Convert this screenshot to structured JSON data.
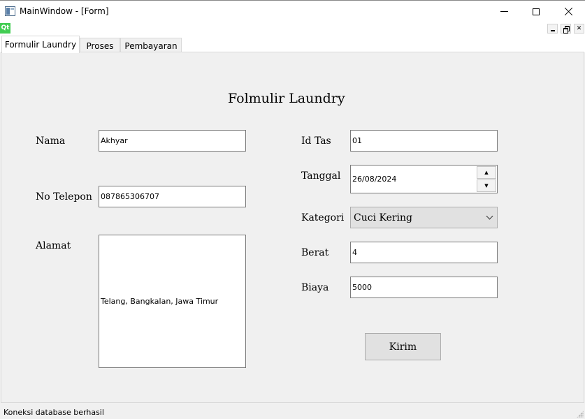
{
  "window": {
    "title": "MainWindow - [Form]",
    "qt_logo_text": "Qt"
  },
  "tabs": [
    {
      "label": "Formulir Laundry",
      "active": true
    },
    {
      "label": "Proses",
      "active": false
    },
    {
      "label": "Pembayaran",
      "active": false
    }
  ],
  "form": {
    "title": "Folmulir Laundry",
    "nama": {
      "label": "Nama",
      "value": "Akhyar"
    },
    "no_telepon": {
      "label": "No Telepon",
      "value": "087865306707"
    },
    "alamat": {
      "label": "Alamat",
      "value": "Telang, Bangkalan, Jawa Timur"
    },
    "id_tas": {
      "label": "Id Tas",
      "value": "01"
    },
    "tanggal": {
      "label": "Tanggal",
      "value": "26/08/2024"
    },
    "kategori": {
      "label": "Kategori",
      "value": "Cuci Kering"
    },
    "berat": {
      "label": "Berat",
      "value": "4"
    },
    "biaya": {
      "label": "Biaya",
      "value": "5000"
    },
    "submit_label": "Kirim"
  },
  "status": {
    "message": "Koneksi database berhasil"
  }
}
